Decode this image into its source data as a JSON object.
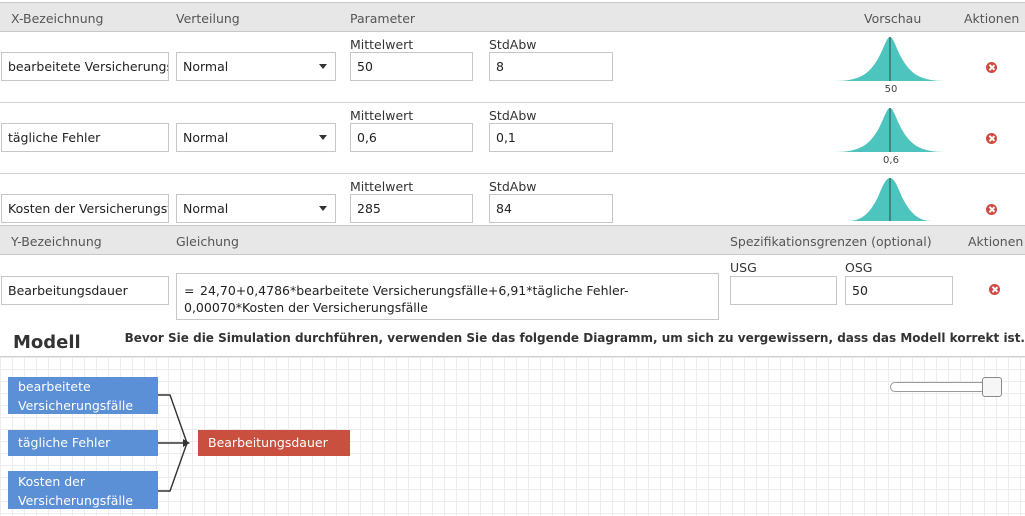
{
  "x_header": {
    "bezeichnung": "X-Bezeichnung",
    "verteilung": "Verteilung",
    "parameter": "Parameter",
    "vorschau": "Vorschau",
    "aktionen": "Aktionen"
  },
  "x_rows": [
    {
      "name": "bearbeitete Versicherungsfälle",
      "name_display": "bearbeitete Versicherungsf",
      "distribution": "Normal",
      "mean_label": "Mittelwert",
      "mean": "50",
      "sd_label": "StdAbw",
      "sd": "8",
      "preview_label": "50"
    },
    {
      "name": "tägliche Fehler",
      "name_display": "tägliche Fehler",
      "distribution": "Normal",
      "mean_label": "Mittelwert",
      "mean": "0,6",
      "sd_label": "StdAbw",
      "sd": "0,1",
      "preview_label": "0,6"
    },
    {
      "name": "Kosten der Versicherungsfälle",
      "name_display": "Kosten der Versicherungsfä",
      "distribution": "Normal",
      "mean_label": "Mittelwert",
      "mean": "285",
      "sd_label": "StdAbw",
      "sd": "84",
      "preview_label": ""
    }
  ],
  "y_header": {
    "bezeichnung": "Y-Bezeichnung",
    "gleichung": "Gleichung",
    "spezifikation": "Spezifikationsgrenzen (optional)",
    "aktionen": "Aktionen"
  },
  "y_row": {
    "name": "Bearbeitungsdauer",
    "equals": "=",
    "equation": "24,70+0,4786*bearbeitete Versicherungsfälle+6,91*tägliche Fehler-0,00070*Kosten der Versicherungsfälle",
    "usg_label": "USG",
    "usg": "",
    "osg_label": "OSG",
    "osg": "50"
  },
  "modell": {
    "title": "Modell",
    "hint": "Bevor Sie die Simulation durchführen, verwenden Sie das folgende Diagramm, um sich zu vergewissern, dass das Modell korrekt ist.",
    "inputs": [
      {
        "line1": "bearbeitete",
        "line2": "Versicherungsfälle"
      },
      {
        "line1": "tägliche Fehler",
        "line2": ""
      },
      {
        "line1": "Kosten der",
        "line2": "Versicherungsfälle"
      }
    ],
    "output": "Bearbeitungsdauer",
    "zoom_level": 1.0
  },
  "colors": {
    "preview_fill": "#4dc4be",
    "preview_line": "#3a6e6b",
    "node_input": "#5b8fd6",
    "node_output": "#c9503f",
    "delete": "#cf4a3f"
  }
}
